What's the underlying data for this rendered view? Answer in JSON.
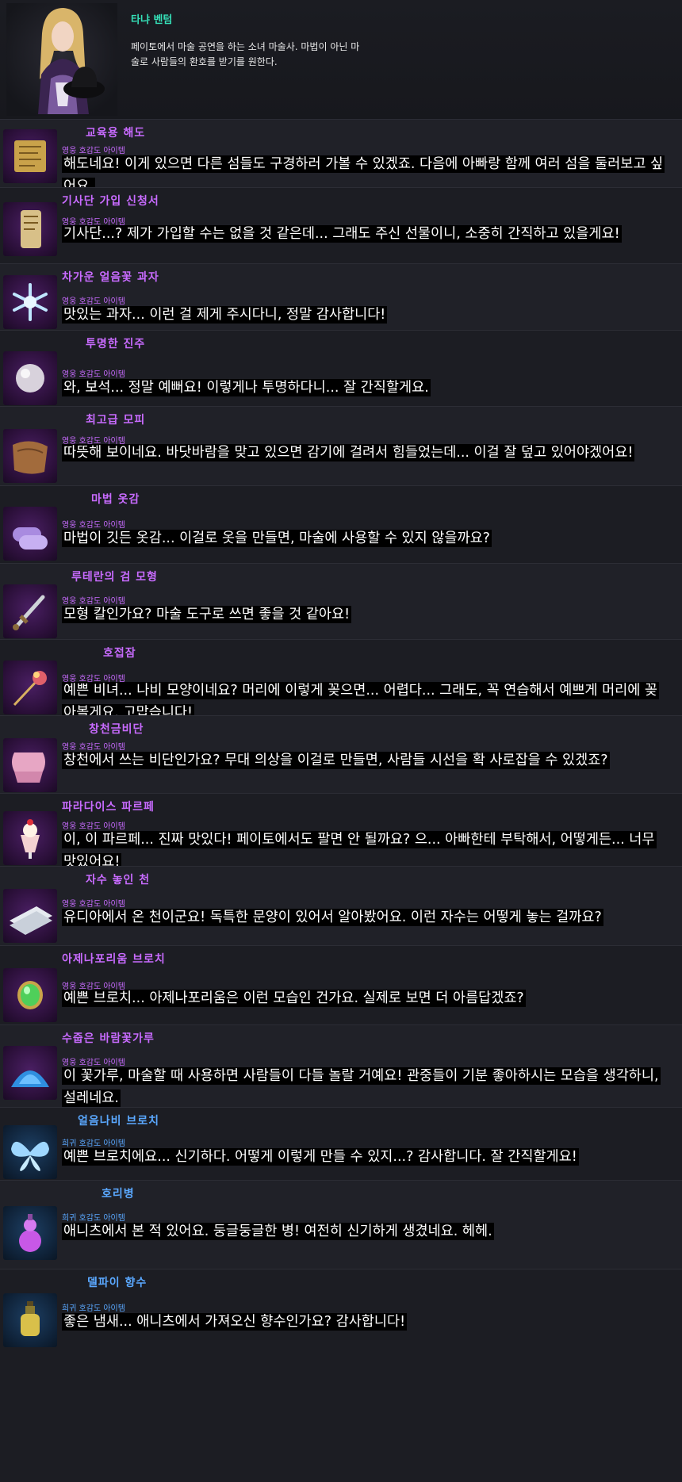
{
  "character": {
    "name": "타냐 벤텀",
    "description": "페이토에서 마술 공연을 하는 소녀 마술사. 마법이 아닌 마술로 사람들의 환호를 받기를 원한다."
  },
  "gifts": [
    {
      "name": "교육용 해도",
      "grade": "영웅 호감도 아이템",
      "icon": "map-scroll-icon",
      "quote": "해도네요! 이게 있으면 다른 섬들도 구경하러 가볼 수 있겠죠. 다음에 아빠랑 함께 여러 섬을 둘러보고 싶어요."
    },
    {
      "name": "기사단 가입 신청서",
      "grade": "영웅 호감도 아이템",
      "icon": "scroll-icon",
      "quote": "기사단...? 제가 가입할 수는 없을 것 같은데... 그래도 주신 선물이니, 소중히 간직하고 있을게요!"
    },
    {
      "name": "차가운 얼음꽃 과자",
      "grade": "영웅 호감도 아이템",
      "icon": "ice-flower-icon",
      "quote": "맛있는 과자... 이런 걸 제게 주시다니, 정말 감사합니다!"
    },
    {
      "name": "투명한 진주",
      "grade": "영웅 호감도 아이템",
      "icon": "pearl-icon",
      "quote": "와, 보석... 정말 예뻐요! 이렇게나 투명하다니... 잘 간직할게요."
    },
    {
      "name": "최고급 모피",
      "grade": "영웅 호감도 아이템",
      "icon": "fur-icon",
      "quote": "따뜻해 보이네요. 바닷바람을 맞고 있으면 감기에 걸려서 힘들었는데... 이걸 잘 덮고 있어야겠어요!"
    },
    {
      "name": "마법 옷감",
      "grade": "영웅 호감도 아이템",
      "icon": "cloth-roll-icon",
      "quote": "마법이 깃든 옷감... 이걸로 옷을 만들면, 마술에 사용할 수 있지 않을까요?"
    },
    {
      "name": "루테란의 검 모형",
      "grade": "영웅 호감도 아이템",
      "icon": "sword-icon",
      "quote": "모형 칼인가요? 마술 도구로 쓰면 좋을 것 같아요!"
    },
    {
      "name": "호접잠",
      "grade": "영웅 호감도 아이템",
      "icon": "hairpin-icon",
      "quote": "예쁜 비녀... 나비 모양이네요? 머리에 이렇게 꽂으면... 어렵다... 그래도, 꼭 연습해서 예쁘게 머리에 꽂아볼게요. 고맙습니다!"
    },
    {
      "name": "창천금비단",
      "grade": "영웅 호감도 아이템",
      "icon": "silk-icon",
      "quote": "창천에서 쓰는 비단인가요? 무대 의상을 이걸로 만들면, 사람들 시선을 확 사로잡을 수 있겠죠?"
    },
    {
      "name": "파라다이스 파르페",
      "grade": "영웅 호감도 아이템",
      "icon": "parfait-icon",
      "quote": "이, 이 파르페... 진짜 맛있다! 페이토에서도 팔면 안 될까요? 으... 아빠한테 부탁해서, 어떻게든... 너무 맛있어요!"
    },
    {
      "name": "자수 놓인 천",
      "grade": "영웅 호감도 아이템",
      "icon": "folded-cloth-icon",
      "quote": "유디아에서 온 천이군요! 독특한 문양이 있어서 알아봤어요. 이런 자수는 어떻게 놓는 걸까요?"
    },
    {
      "name": "아제나포리움 브로치",
      "grade": "영웅 호감도 아이템",
      "icon": "green-gem-brooch-icon",
      "quote": "예쁜 브로치... 아제나포리움은 이런 모습인 건가요. 실제로 보면 더 아름답겠죠?"
    },
    {
      "name": "수줍은 바람꽃가루",
      "grade": "영웅 호감도 아이템",
      "icon": "blue-powder-icon",
      "quote": "이 꽃가루, 마술할 때 사용하면 사람들이 다들 놀랄 거예요! 관중들이 기분 좋아하시는 모습을 생각하니, 설레네요."
    },
    {
      "name": "얼음나비 브로치",
      "grade": "희귀 호감도 아이템",
      "icon": "butterfly-icon",
      "quote": "예쁜 브로치에요... 신기하다. 어떻게 이렇게 만들 수 있지...? 감사합니다. 잘 간직할게요!"
    },
    {
      "name": "호리병",
      "grade": "희귀 호감도 아이템",
      "icon": "gourd-bottle-icon",
      "quote": "애니츠에서 본 적 있어요. 둥글둥글한 병! 여전히 신기하게 생겼네요. 헤헤."
    },
    {
      "name": "델파이 향수",
      "grade": "희귀 호감도 아이템",
      "icon": "perfume-icon",
      "quote": "좋은 냄새... 애니츠에서 가져오신 향수인가요? 감사합니다!"
    }
  ]
}
